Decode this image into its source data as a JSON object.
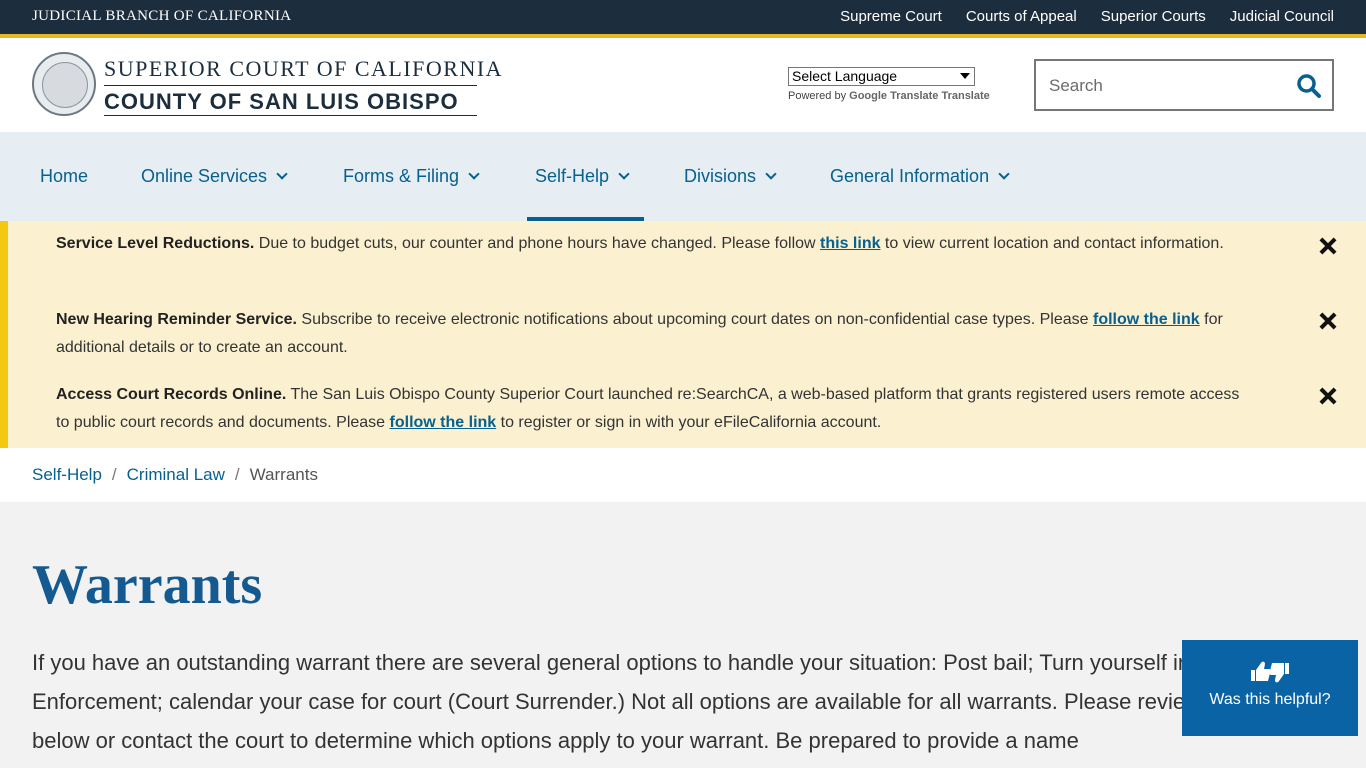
{
  "topbar": {
    "brand": "JUDICIAL BRANCH OF CALIFORNIA",
    "links": [
      "Supreme Court",
      "Courts of Appeal",
      "Superior Courts",
      "Judicial Council"
    ]
  },
  "header": {
    "logo_line1": "SUPERIOR COURT OF CALIFORNIA",
    "logo_line2": "COUNTY OF SAN LUIS OBISPO",
    "language_select": "Select Language",
    "powered_by": "Powered by",
    "translate_label": "Google Translate Translate",
    "search_placeholder": "Search"
  },
  "nav": {
    "items": [
      {
        "label": "Home"
      },
      {
        "label": "Online Services"
      },
      {
        "label": "Forms & Filing"
      },
      {
        "label": "Self-Help"
      },
      {
        "label": "Divisions"
      },
      {
        "label": "General Information"
      }
    ],
    "active": "Self-Help"
  },
  "alerts": [
    {
      "title": "Service Level Reductions.",
      "before": " Due to budget cuts, our counter and phone hours have changed. Please follow ",
      "link": "this link",
      "after": " to view current location and contact information."
    },
    {
      "title": "New Hearing Reminder Service.",
      "before": " Subscribe to receive electronic notifications about upcoming court dates on non-confidential case types. Please ",
      "link": "follow the link",
      "after": " for additional details or to create an account."
    },
    {
      "title": "Access Court Records Online.",
      "before": " The San Luis Obispo County Superior Court launched re:SearchCA, a web-based platform that grants registered users remote access to public court records and documents. Please ",
      "link": "follow the link",
      "after": " to register or sign in with your eFileCalifornia account."
    }
  ],
  "breadcrumb": {
    "items": [
      "Self-Help",
      "Criminal Law"
    ],
    "separator": "/",
    "current": "Warrants"
  },
  "main": {
    "title": "Warrants",
    "intro": "If you have an outstanding warrant there are several general options to handle your situation: Post bail; Turn yourself in to Law Enforcement; calendar your case for court (Court Surrender.) Not all options are available for all warrants. Please review the details below or contact the court to determine which options apply to your warrant. Be prepared to provide a name"
  },
  "helpful": {
    "label": "Was this helpful?"
  },
  "colors": {
    "topbar": "#1c2d3d",
    "gold": "#e8b722",
    "nav_bg": "#e6eef3",
    "link": "#07608f",
    "alert_bg": "#fbf1d0",
    "helpful_bg": "#0a63a5"
  }
}
